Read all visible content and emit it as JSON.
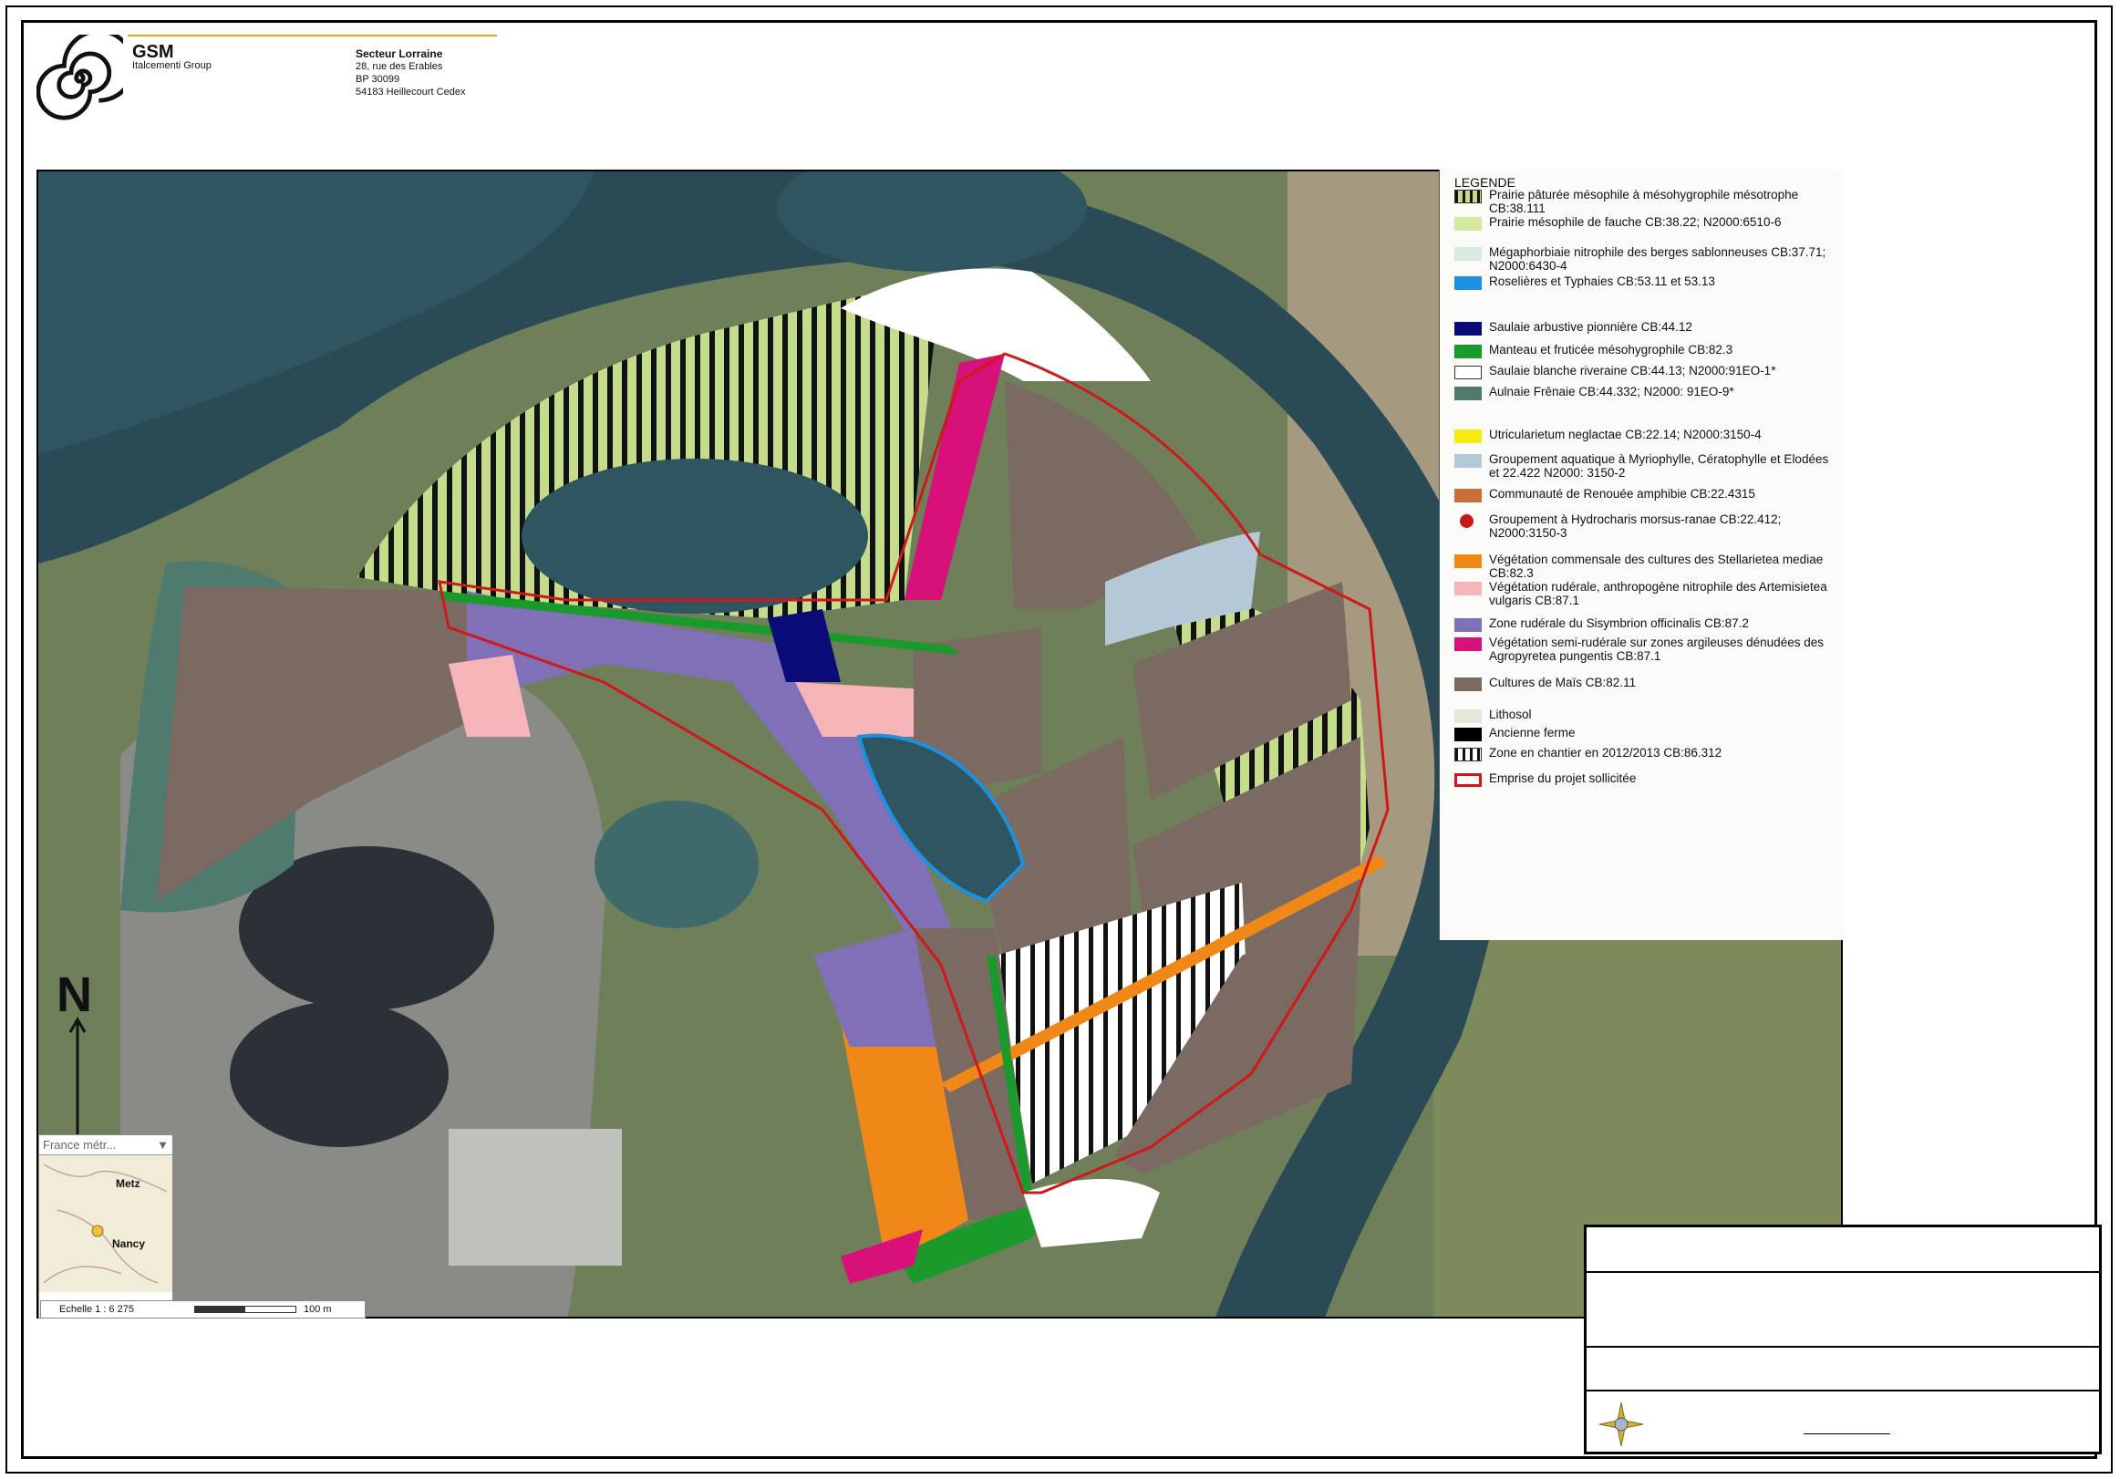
{
  "header": {
    "company": "GSM",
    "group": "Italcementi Group",
    "sector_title": "Secteur Lorraine",
    "address_lines": [
      "28, rue des Erables",
      "BP 30099",
      "54183 Heillecourt Cedex"
    ]
  },
  "legend": {
    "title": "LEGENDE",
    "items": [
      {
        "label": "Prairie pâturée mésophile à mésohygrophile mésotrophe CB:38.111",
        "color": "#c5dc8c",
        "pattern": "black-stripes"
      },
      {
        "label": "Prairie mésophile de fauche CB:38.22; N2000:6510-6",
        "color": "#d4e8a0"
      },
      {
        "label": "Mégaphorbiaie nitrophile des berges sablonneuses CB:37.71; N2000:6430-4",
        "color": "#d8eadf"
      },
      {
        "label": "Roselières et Typhaies CB:53.11 et 53.13",
        "color": "#1e90e0"
      },
      {
        "label": "Saulaie arbustive pionnière CB:44.12",
        "color": "#0a0a78"
      },
      {
        "label": "Manteau et fruticée mésohygrophile CB:82.3",
        "color": "#1a9a2a"
      },
      {
        "label": "Saulaie blanche riveraine CB:44.13; N2000:91EO-1*",
        "color": "#ffffff"
      },
      {
        "label": "Aulnaie Frênaie CB:44.332; N2000: 91EO-9*",
        "color": "#4f7a6e"
      },
      {
        "label": "Utricularietum neglactae CB:22.14; N2000:3150-4",
        "color": "#f4ec10"
      },
      {
        "label": "Groupement aquatique à Myriophylle, Cératophylle et Elodées et 22.422 N2000: 3150-2",
        "color": "#b4c8d8"
      },
      {
        "label": "Communauté de Renouée amphibie CB:22.4315",
        "color": "#c8703a"
      },
      {
        "label": "Groupement à Hydrocharis morsus-ranae CB:22.412; N2000:3150-3",
        "color": "#c81818",
        "pattern": "dot"
      },
      {
        "label": "Végétation commensale des cultures des Stellarietea mediae CB:82.3",
        "color": "#f08818"
      },
      {
        "label": "Végétation rudérale, anthropogène nitrophile des Artemisietea vulgaris CB:87.1",
        "color": "#f4b4b8"
      },
      {
        "label": "Zone rudérale du Sisymbrion officinalis CB:87.2",
        "color": "#8070b8"
      },
      {
        "label": "Végétation semi-rudérale sur zones argileuses dénudées des Agropyretea pungentis CB:87.1",
        "color": "#d8107a"
      },
      {
        "label": "Cultures de Maïs CB:82.11",
        "color": "#7a6a62"
      },
      {
        "label": "Lithosol",
        "color": "#e4e8d8"
      },
      {
        "label": "Ancienne ferme",
        "color": "#000000"
      },
      {
        "label": "Zone en chantier en 2012/2013 CB:86.312",
        "color": "#ffffff",
        "pattern": "black-stripes"
      },
      {
        "label": "Emprise du projet sollicitée",
        "color": "#ffffff",
        "pattern": "red-outline"
      }
    ]
  },
  "map": {
    "north_label": "N",
    "inset_select": "France métr...",
    "inset_cities": [
      "Metz",
      "Nancy"
    ],
    "scale_text": "Echelle 1 : 6 275",
    "scale_bar_label": "100 m"
  },
  "colors": {
    "accent_line": "#e8a020",
    "river": "#2a4a55",
    "project_outline": "#d01818"
  }
}
